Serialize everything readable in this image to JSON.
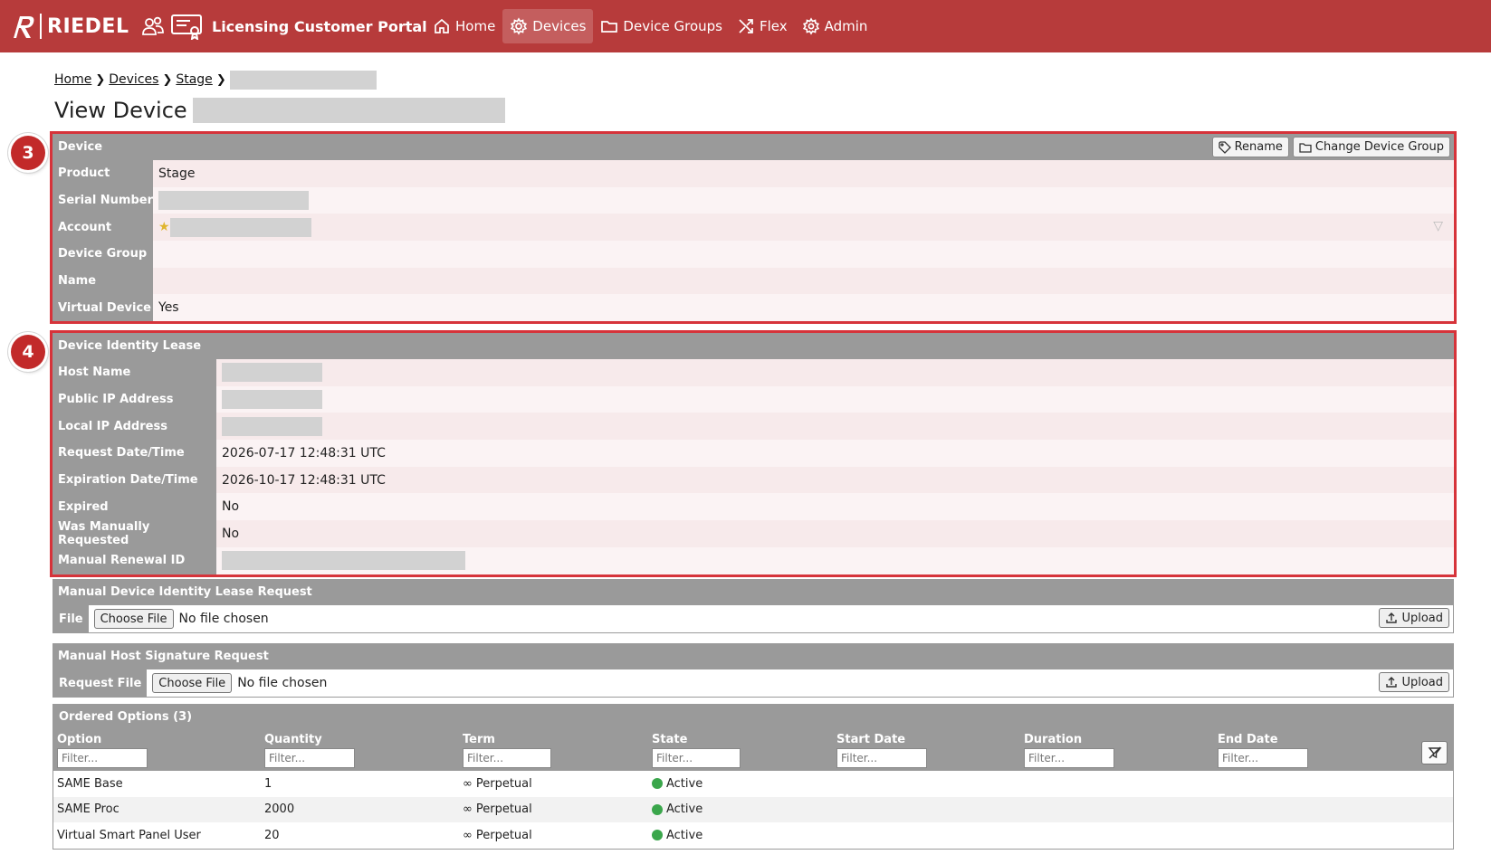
{
  "app": {
    "brand": "RIEDEL",
    "portal_title": "Licensing Customer Portal"
  },
  "nav": [
    {
      "label": "Home",
      "icon": "home-icon"
    },
    {
      "label": "Devices",
      "icon": "gear-icon",
      "active": true
    },
    {
      "label": "Device Groups",
      "icon": "folder-icon"
    },
    {
      "label": "Flex",
      "icon": "shuffle-icon"
    },
    {
      "label": "Admin",
      "icon": "settings-icon"
    }
  ],
  "breadcrumb": [
    {
      "label": "Home"
    },
    {
      "label": "Devices"
    },
    {
      "label": "Stage"
    }
  ],
  "page_title": "View Device",
  "device_panel": {
    "step": "3",
    "title": "Device",
    "rename_label": "Rename",
    "change_group_label": "Change Device Group",
    "rows": [
      {
        "key": "Product",
        "value": "Stage"
      },
      {
        "key": "Serial Number",
        "value": ""
      },
      {
        "key": "Account",
        "value": ""
      },
      {
        "key": "Device Group",
        "value": ""
      },
      {
        "key": "Name",
        "value": ""
      },
      {
        "key": "Virtual Device",
        "value": "Yes"
      }
    ]
  },
  "lease_panel": {
    "step": "4",
    "title": "Device Identity Lease",
    "rows": [
      {
        "key": "Host Name",
        "value": ""
      },
      {
        "key": "Public IP Address",
        "value": ""
      },
      {
        "key": "Local IP Address",
        "value": ""
      },
      {
        "key": "Request Date/Time",
        "value": "2026-07-17 12:48:31 UTC"
      },
      {
        "key": "Expiration Date/Time",
        "value": "2026-10-17 12:48:31 UTC"
      },
      {
        "key": "Expired",
        "value": "No"
      },
      {
        "key": "Was Manually Requested",
        "value": "No"
      },
      {
        "key": "Manual Renewal ID",
        "value": ""
      }
    ]
  },
  "manual_lease": {
    "title": "Manual Device Identity Lease Request",
    "file_label": "File",
    "choose_label": "Choose File",
    "no_file": "No file chosen",
    "upload_label": "Upload"
  },
  "host_signature": {
    "title": "Manual Host Signature Request",
    "file_label": "Request File",
    "choose_label": "Choose File",
    "no_file": "No file chosen",
    "upload_label": "Upload"
  },
  "options_table": {
    "title": "Ordered Options (3)",
    "filter_placeholder": "Filter...",
    "columns": [
      "Option",
      "Quantity",
      "Term",
      "State",
      "Start Date",
      "Duration",
      "End Date"
    ],
    "rows": [
      {
        "option": "SAME Base",
        "quantity": "1",
        "term": "Perpetual",
        "state": "Active"
      },
      {
        "option": "SAME Proc",
        "quantity": "2000",
        "term": "Perpetual",
        "state": "Active"
      },
      {
        "option": "Virtual Smart Panel User",
        "quantity": "20",
        "term": "Perpetual",
        "state": "Active"
      }
    ],
    "state_color": "#3aa64b"
  },
  "colors": {
    "topbar": "#b73b3b",
    "panel_header": "#9a9a9a",
    "highlight": "#d6333a",
    "badge": "#c22a2a"
  }
}
